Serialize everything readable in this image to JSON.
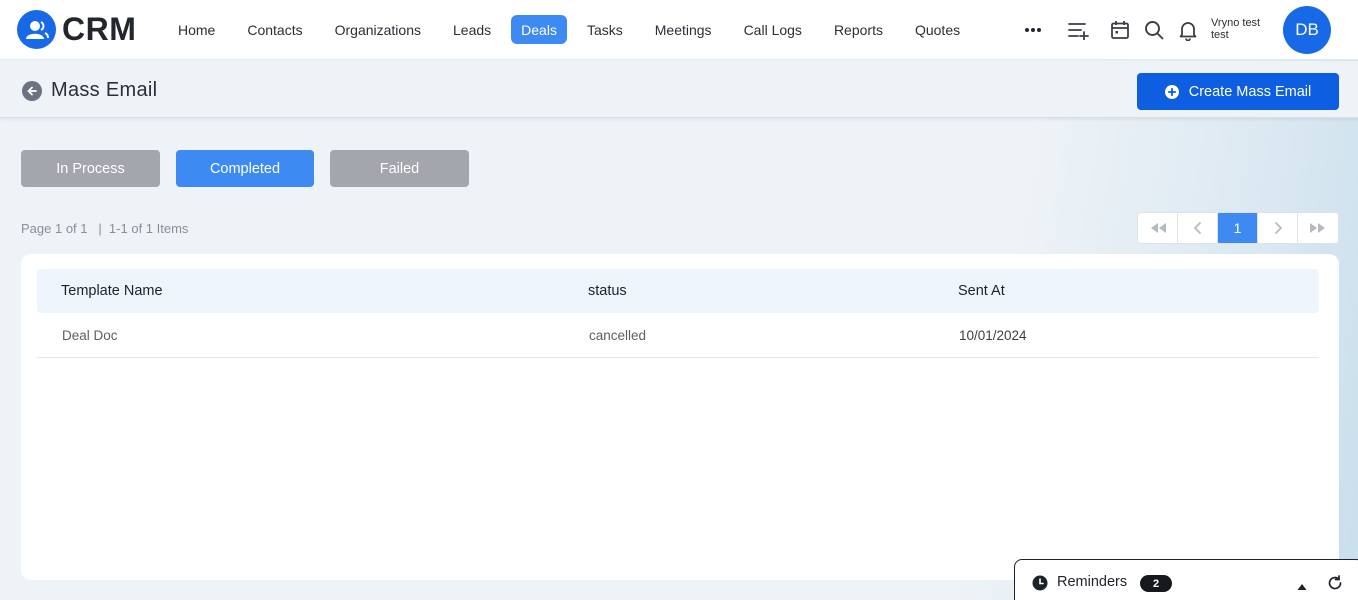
{
  "app": {
    "logo_text": "CRM"
  },
  "nav": {
    "items": [
      {
        "label": "Home",
        "active": false
      },
      {
        "label": "Contacts",
        "active": false
      },
      {
        "label": "Organizations",
        "active": false
      },
      {
        "label": "Leads",
        "active": false
      },
      {
        "label": "Deals",
        "active": true
      },
      {
        "label": "Tasks",
        "active": false
      },
      {
        "label": "Meetings",
        "active": false
      },
      {
        "label": "Call Logs",
        "active": false
      },
      {
        "label": "Reports",
        "active": false
      },
      {
        "label": "Quotes",
        "active": false
      }
    ],
    "more_icon": "more-horizontal-icon",
    "tools": [
      "add-list-icon",
      "calendar-icon",
      "search-icon",
      "bell-icon"
    ]
  },
  "user": {
    "name": "Vryno test test",
    "initials": "DB"
  },
  "header": {
    "title": "Mass Email",
    "create_label": "Create Mass Email"
  },
  "tabs": [
    {
      "label": "In Process",
      "active": false
    },
    {
      "label": "Completed",
      "active": true
    },
    {
      "label": "Failed",
      "active": false
    }
  ],
  "pagination": {
    "page_info": "Page 1 of 1   |  1-1 of 1 Items",
    "current_page": "1"
  },
  "table": {
    "columns": [
      "Template Name",
      "status",
      "Sent At"
    ],
    "rows": [
      {
        "template_name": "Deal Doc",
        "status": "cancelled",
        "sent_at": "10/01/2024"
      }
    ]
  },
  "reminders": {
    "label": "Reminders",
    "count": "2"
  },
  "colors": {
    "primary": "#1769e8",
    "accent": "#3d8bf2",
    "inactive_tab": "#a3a6ad"
  }
}
